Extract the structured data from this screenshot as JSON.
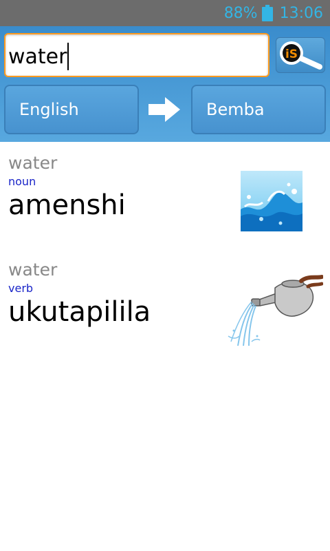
{
  "status_bar": {
    "battery_percent": "88%",
    "time": "13:06",
    "icon": "battery-icon"
  },
  "search": {
    "value": "water",
    "button_icon": "search-magnifier-icon",
    "logo_text": "iS"
  },
  "languages": {
    "from": "English",
    "to": "Bemba",
    "swap_icon": "arrow-right-icon"
  },
  "results": [
    {
      "word": "water",
      "part_of_speech": "noun",
      "translation": "amenshi",
      "image": "water-splash-image"
    },
    {
      "word": "water",
      "part_of_speech": "verb",
      "translation": "ukutapilila",
      "image": "watering-can-image"
    }
  ],
  "colors": {
    "accent": "#33b5e5",
    "header": "#4a9bd6",
    "focus": "#ff9a1e",
    "pos_text": "#1a25c8"
  }
}
